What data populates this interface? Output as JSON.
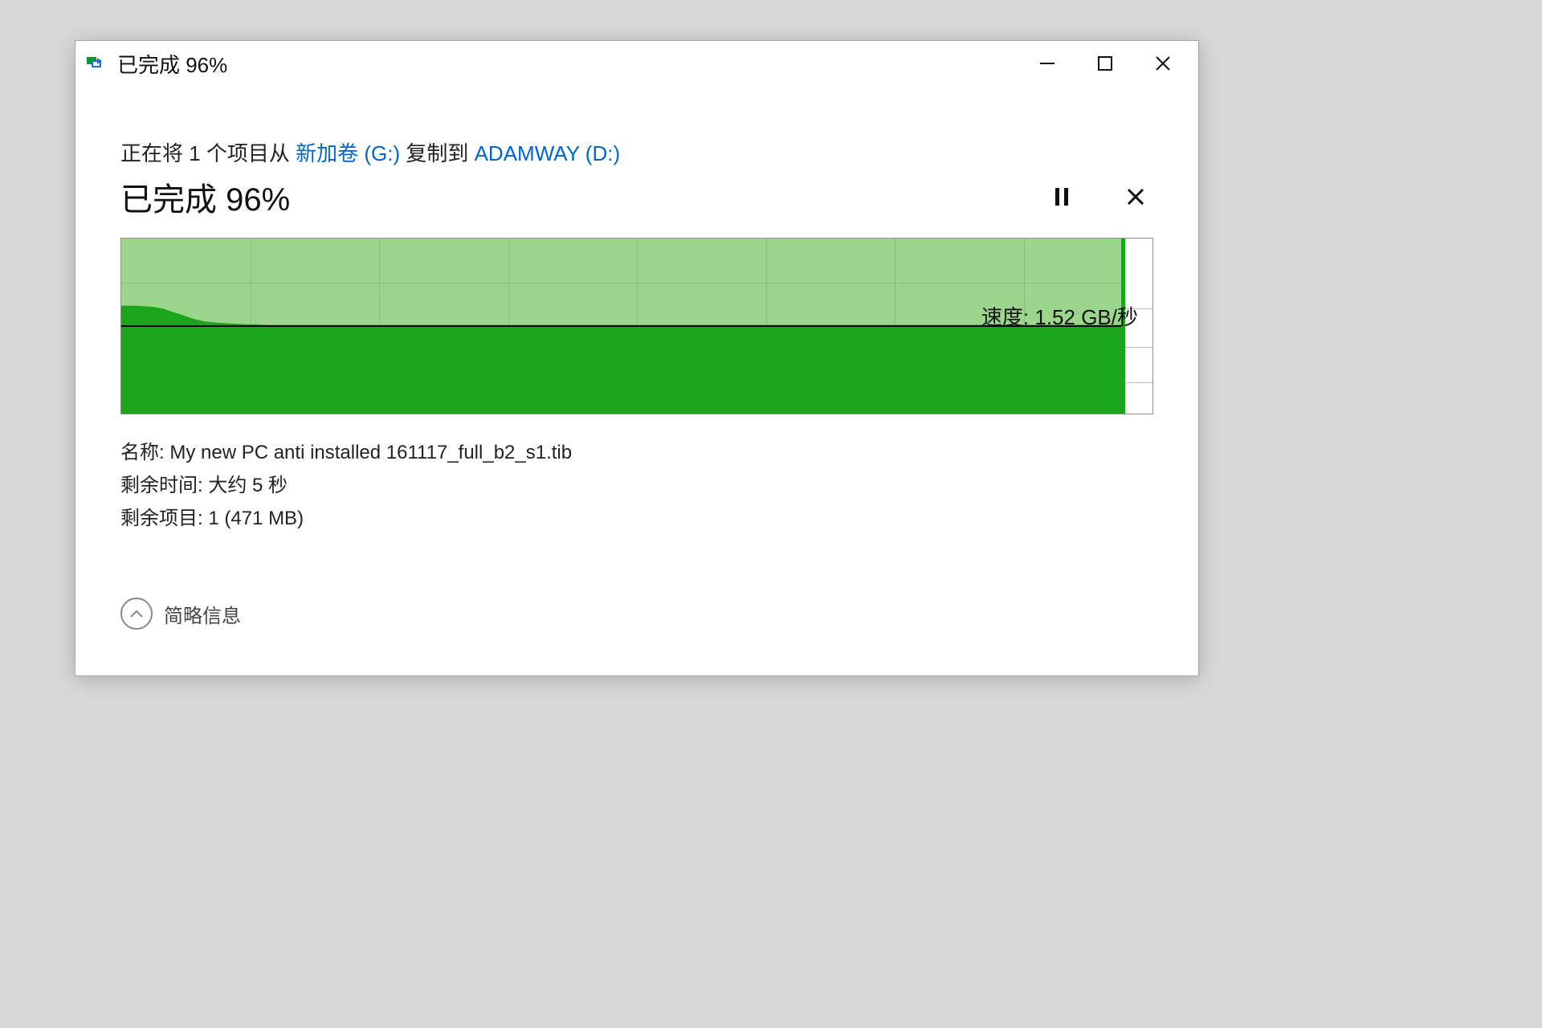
{
  "titlebar": {
    "title": "已完成 96%"
  },
  "copy_line": {
    "prefix": "正在将 1 个项目从 ",
    "source": "新加卷 (G:)",
    "mid": " 复制到 ",
    "dest": "ADAMWAY (D:)"
  },
  "progress": {
    "title": "已完成 96%"
  },
  "speed": {
    "label": "速度: 1.52 GB/秒"
  },
  "details": {
    "name_label": "名称: ",
    "name_value": "My new PC anti installed 161117_full_b2_s1.tib",
    "time_label": "剩余时间: ",
    "time_value": "大约 5 秒",
    "items_label": "剩余项目: ",
    "items_value": "1 (471 MB)"
  },
  "collapse": {
    "label": "简略信息"
  },
  "chart_data": {
    "type": "area",
    "title": "",
    "xlabel": "",
    "ylabel": "",
    "ylim": [
      0,
      3.0
    ],
    "progress_pct": 97,
    "series": [
      {
        "name": "transfer-speed-GB/s",
        "values": [
          1.85,
          1.85,
          1.84,
          1.83,
          1.8,
          1.74,
          1.68,
          1.62,
          1.58,
          1.56,
          1.55,
          1.54,
          1.53,
          1.53,
          1.52,
          1.52,
          1.52,
          1.52,
          1.52,
          1.52,
          1.52,
          1.52,
          1.52,
          1.52,
          1.52,
          1.52,
          1.52,
          1.52,
          1.52,
          1.52,
          1.52,
          1.52,
          1.52,
          1.52,
          1.52,
          1.52,
          1.52,
          1.52,
          1.52,
          1.52,
          1.52,
          1.52,
          1.52,
          1.52,
          1.52,
          1.52,
          1.52,
          1.52,
          1.52,
          1.52,
          1.52,
          1.52,
          1.52,
          1.52,
          1.52,
          1.52,
          1.52,
          1.52,
          1.52,
          1.52,
          1.52,
          1.52,
          1.52,
          1.52,
          1.52,
          1.52,
          1.52,
          1.52,
          1.52,
          1.52,
          1.52,
          1.52,
          1.52,
          1.52,
          1.52,
          1.52,
          1.52,
          1.52,
          1.52,
          1.52,
          1.52,
          1.52,
          1.52,
          1.52,
          1.52,
          1.52,
          1.52,
          1.52,
          1.52,
          1.52,
          1.52,
          1.52,
          1.52,
          1.52,
          1.52,
          1.52,
          1.52
        ]
      }
    ]
  }
}
